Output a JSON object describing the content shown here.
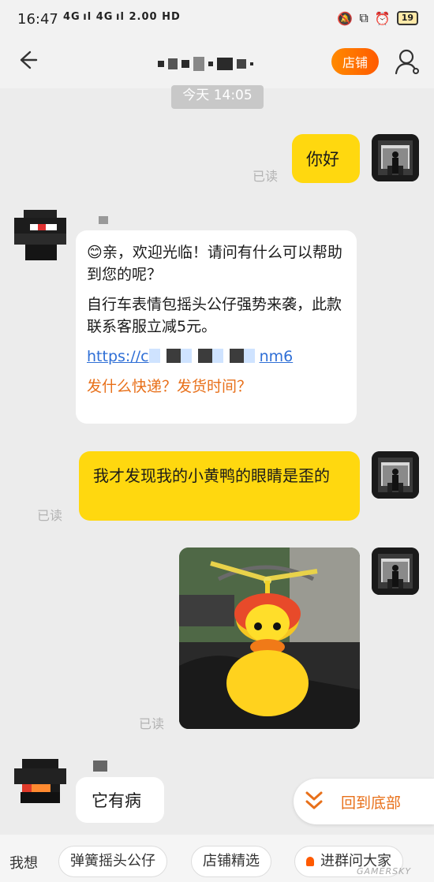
{
  "status_bar": {
    "time": "16:47",
    "network": "4G ıl 4G ıl 2.00 HD",
    "battery": "19"
  },
  "header": {
    "shop_button": "店铺"
  },
  "timestamp": "今天 14:05",
  "messages": {
    "m1": {
      "text": "你好",
      "read": "已读"
    },
    "m2": {
      "greeting": "亲，欢迎光临！请问有什么可以帮助到您的呢？",
      "promo": "自行车表情包摇头公仔强势来袭，此款联系客服立减5元。",
      "link_start": "https://c",
      "link_end": "nm6",
      "quick_question": "发什么快递？发货时间？"
    },
    "m3": {
      "text": "我才发现我的小黄鸭的眼睛是歪的",
      "read": "已读"
    },
    "m4": {
      "read": "已读"
    },
    "m5": {
      "text": "它有病"
    }
  },
  "scroll_to_bottom": "回到底部",
  "quick_bar": {
    "label": "我想",
    "chips": [
      "弹簧摇头公仔",
      "店铺精选",
      "进群问大家"
    ]
  },
  "watermark": "GAMERSKY"
}
